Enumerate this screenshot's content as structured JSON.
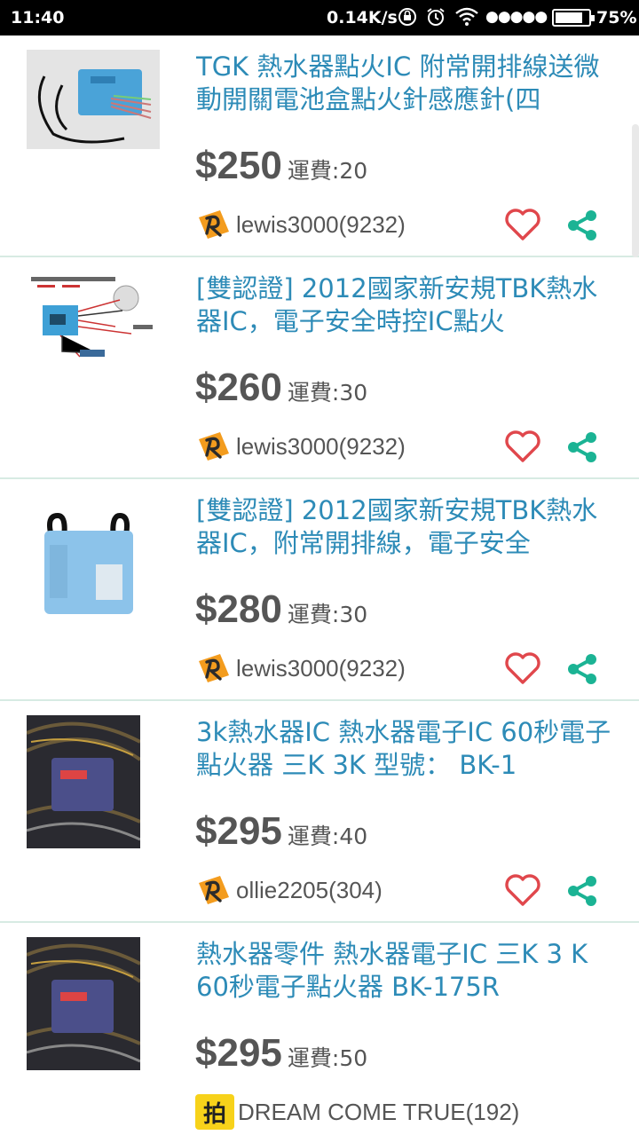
{
  "status_bar": {
    "time": "11:40",
    "network_speed": "0.14K/s",
    "signal_dots": "●●●●●",
    "battery": "75%",
    "icons": [
      "rotation-lock-icon",
      "alarm-icon",
      "wifi-icon",
      "battery-icon"
    ]
  },
  "colors": {
    "title": "#2d8bb7",
    "price": "#555555",
    "heart": "#e0474c",
    "share": "#1bb394",
    "divider": "#d7ebe3"
  },
  "listings": [
    {
      "title": "TGK 熱水器點火IC 附常開排線送微動開關電池盒點火針感應針(四",
      "price": "$250",
      "shipping": "運費:20",
      "seller": "lewis3000(9232)",
      "seller_badge": "orange-seller-badge-icon",
      "thumb": "blue-ignition-module-photo"
    },
    {
      "title": "[雙認證] 2012國家新安規TBK熱水器IC，電子安全時控IC點火",
      "price": "$260",
      "shipping": "運費:30",
      "seller": "lewis3000(9232)",
      "seller_badge": "orange-seller-badge-icon",
      "thumb": "wiring-diagram-photo"
    },
    {
      "title": "[雙認證] 2012國家新安規TBK熱水器IC，附常開排線，電子安全",
      "price": "$280",
      "shipping": "運費:30",
      "seller": "lewis3000(9232)",
      "seller_badge": "orange-seller-badge-icon",
      "thumb": "light-blue-ic-module-photo"
    },
    {
      "title": "3k熱水器IC 熱水器電子IC 60秒電子點火器 三K 3K 型號： BK-1",
      "price": "$295",
      "shipping": "運費:40",
      "seller": "ollie2205(304)",
      "seller_badge": "orange-seller-badge-icon",
      "thumb": "wrapped-ic-module-photo"
    },
    {
      "title": "熱水器零件 熱水器電子IC 三K 3 K 60秒電子點火器 BK-175R",
      "price": "$295",
      "shipping": "運費:50",
      "seller": "DREAM COME TRUE(192)",
      "seller_badge": "yellow-seller-badge-icon",
      "seller_badge_text": "拍",
      "thumb": "wrapped-ic-module-photo"
    }
  ]
}
